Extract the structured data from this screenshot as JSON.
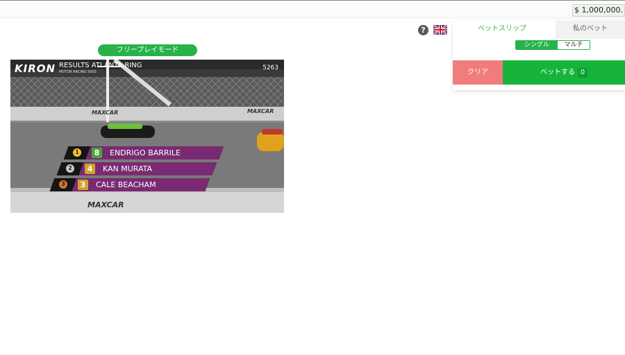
{
  "header": {
    "balance": "$ 1,000,000."
  },
  "icons": {
    "help": "help-circle-icon",
    "language": "uk-flag-icon"
  },
  "mode_label": "フリープレイモード",
  "video": {
    "logo": "KIRON",
    "title": "RESULTS ATLANTA RING",
    "subtitle": "MOTOR RACING    5003",
    "event_id": "5263",
    "track_banner_text": "MAXCAR",
    "results": [
      {
        "position": "1",
        "car_number": "8",
        "driver": "ENDRIGO BARRILE",
        "medal_color": "#f2c12e",
        "number_color": "#46a83a"
      },
      {
        "position": "2",
        "car_number": "4",
        "driver": "KAN MURATA",
        "medal_color": "#c8c8c8",
        "number_color": "#d4a22a"
      },
      {
        "position": "3",
        "car_number": "3",
        "driver": "CALE BEACHAM",
        "medal_color": "#d2762e",
        "number_color": "#d4a22a"
      }
    ]
  },
  "betslip": {
    "tab_active": "ベットスリップ",
    "tab_inactive": "私のベット",
    "type_single": "シングル",
    "type_multi": "マルチ",
    "clear_label": "クリア",
    "bet_label": "ベットする",
    "bet_count": "0"
  },
  "colors": {
    "accent_green": "#27b34a",
    "clear_red": "#f17c7c",
    "result_purple": "#7a2a72"
  }
}
